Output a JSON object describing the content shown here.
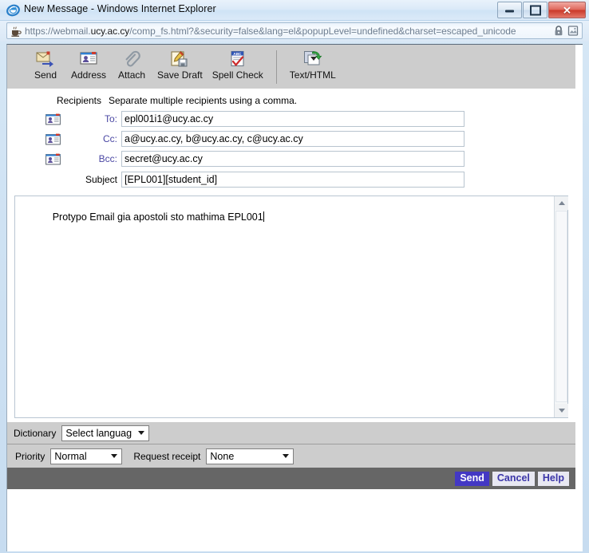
{
  "window": {
    "title": "New Message - Windows Internet Explorer",
    "icon": "internet-explorer-icon",
    "buttons": {
      "minimize": "Minimize",
      "maximize": "Maximize",
      "close": "Close"
    }
  },
  "address_bar": {
    "scheme": "https://",
    "domain": "webmail.ucy.ac.cy",
    "path": "/comp_fs.html?&security=false&lang=el&popupLevel=undefined&charset=escaped_unicode",
    "full_url": "https://webmail.ucy.ac.cy/comp_fs.html?&security=false&lang=el&popupLevel=undefined&charset=escaped_unicode",
    "lock_icon": "lock-icon",
    "compat_icon": "compatibility-view-icon"
  },
  "toolbar": {
    "items": [
      {
        "label": "Send",
        "icon": "send-envelope-icon"
      },
      {
        "label": "Address",
        "icon": "address-book-icon"
      },
      {
        "label": "Attach",
        "icon": "paperclip-icon"
      },
      {
        "label": "Save Draft",
        "icon": "save-draft-icon"
      },
      {
        "label": "Spell Check",
        "icon": "spell-check-icon"
      },
      {
        "label": "Text/HTML",
        "icon": "text-html-toggle-icon"
      }
    ]
  },
  "fields": {
    "recipients_label": "Recipients",
    "recipients_hint": "Separate multiple recipients using a comma.",
    "to": {
      "label": "To:",
      "value": "epl001i1@ucy.ac.cy",
      "icon": "address-book-icon"
    },
    "cc": {
      "label": "Cc:",
      "value": "a@ucy.ac.cy, b@ucy.ac.cy, c@ucy.ac.cy",
      "icon": "address-book-icon"
    },
    "bcc": {
      "label": "Bcc:",
      "value": "secret@ucy.ac.cy",
      "icon": "address-book-icon"
    },
    "subject": {
      "label": "Subject",
      "value": "[EPL001][student_id]"
    }
  },
  "body": {
    "text": "Protypo Email gia apostoli sto mathima EPL001",
    "scrollbar": {
      "up": "scroll-up-arrow-icon",
      "down": "scroll-down-arrow-icon"
    }
  },
  "options": {
    "dictionary_label": "Dictionary",
    "dictionary_value": "Select language",
    "priority_label": "Priority",
    "priority_value": "Normal",
    "receipt_label": "Request receipt",
    "receipt_value": "None"
  },
  "footer": {
    "send": "Send",
    "cancel": "Cancel",
    "help": "Help"
  },
  "colors": {
    "toolbar_bg": "#cdcdcd",
    "footer_bg": "#666666",
    "send_button_bg": "#4338c4",
    "secondary_button_bg": "#e8e8f2",
    "link_label": "#4a47a3"
  }
}
